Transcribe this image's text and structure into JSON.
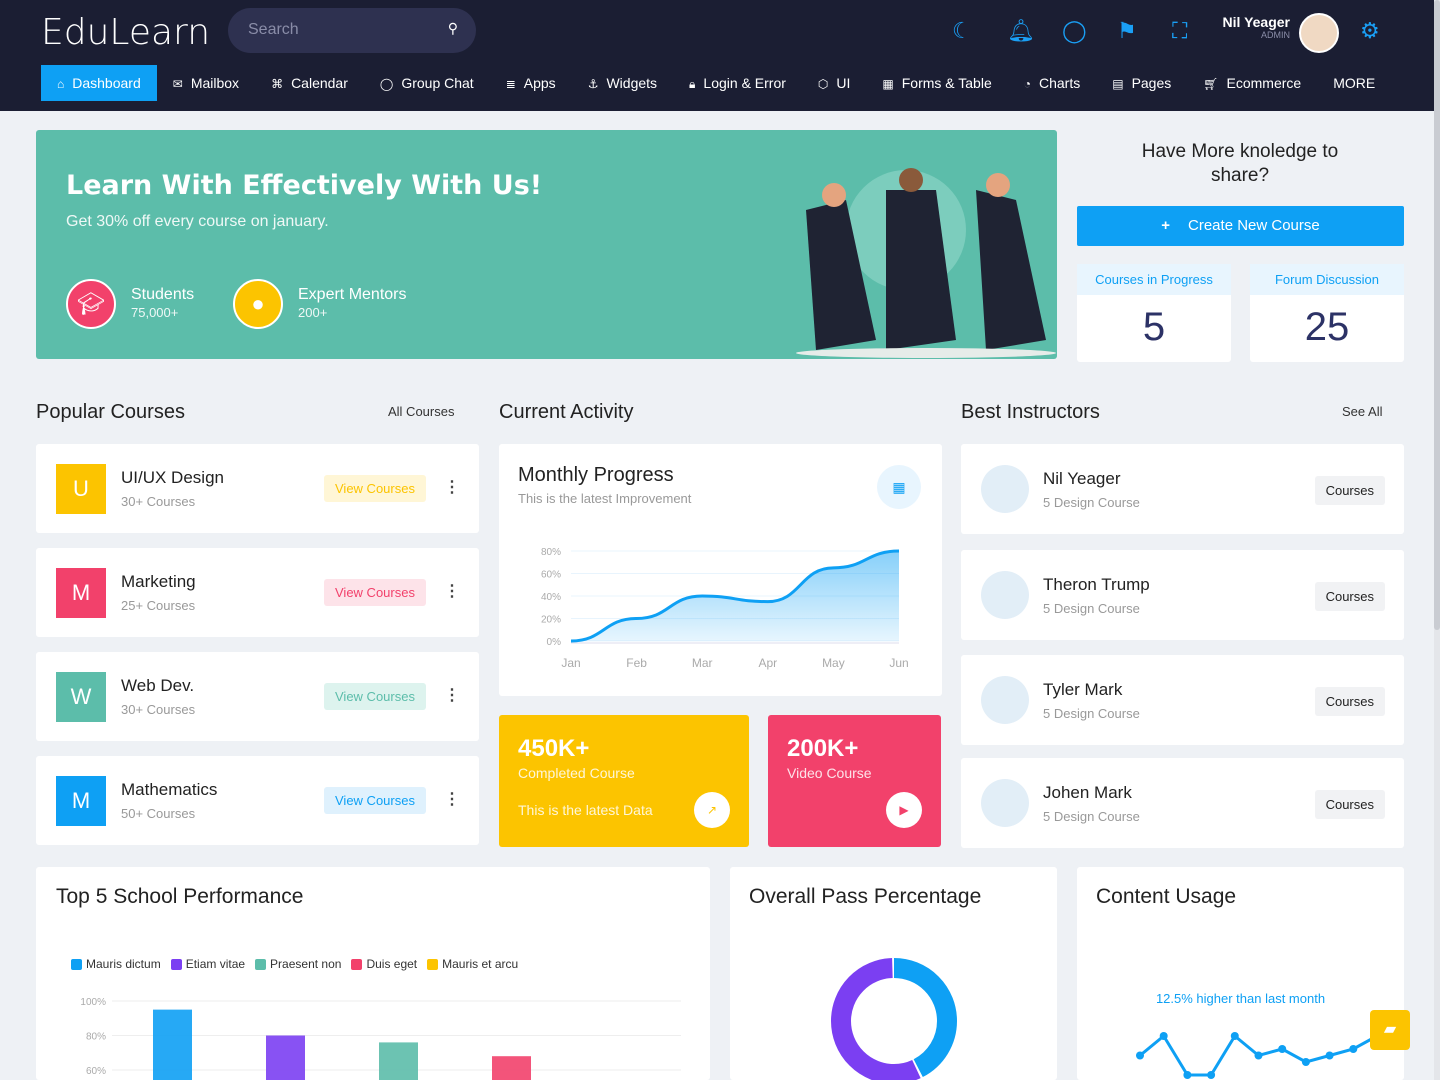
{
  "header": {
    "logo": "EduLearn",
    "search_placeholder": "Search",
    "user_name": "Nil Yeager",
    "user_role": "ADMIN"
  },
  "nav": [
    {
      "label": "Dashboard",
      "icon": "home-icon",
      "active": true
    },
    {
      "label": "Mailbox",
      "icon": "mail-icon"
    },
    {
      "label": "Calendar",
      "icon": "command-icon"
    },
    {
      "label": "Group Chat",
      "icon": "chat-icon"
    },
    {
      "label": "Apps",
      "icon": "database-icon"
    },
    {
      "label": "Widgets",
      "icon": "anchor-icon"
    },
    {
      "label": "Login & Error",
      "icon": "lock-icon"
    },
    {
      "label": "UI",
      "icon": "box-icon"
    },
    {
      "label": "Forms & Table",
      "icon": "table-icon"
    },
    {
      "label": "Charts",
      "icon": "pie-icon"
    },
    {
      "label": "Pages",
      "icon": "file-icon"
    },
    {
      "label": "Ecommerce",
      "icon": "cart-icon"
    },
    {
      "label": "MORE"
    }
  ],
  "hero": {
    "title": "Learn With Effectively With Us!",
    "subtitle": "Get 30% off every course on january.",
    "stats": [
      {
        "label": "Students",
        "value": "75,000+"
      },
      {
        "label": "Expert Mentors",
        "value": "200+"
      }
    ]
  },
  "side": {
    "title": "Have More knoledge to share?",
    "create": "Create New Course",
    "boxes": [
      {
        "label": "Courses in Progress",
        "value": "5"
      },
      {
        "label": "Forum Discussion",
        "value": "25"
      }
    ]
  },
  "popular": {
    "title": "Popular Courses",
    "link": "All Courses",
    "button": "View Courses",
    "items": [
      {
        "letter": "U",
        "name": "UI/UX Design",
        "count": "30+ Courses",
        "color": "#fcc400",
        "bg": "#fff6d6"
      },
      {
        "letter": "M",
        "name": "Marketing",
        "count": "25+ Courses",
        "color": "#f2416b",
        "bg": "#fde3e9"
      },
      {
        "letter": "W",
        "name": "Web Dev.",
        "count": "30+ Courses",
        "color": "#5cbdaa",
        "bg": "#ddf3ee"
      },
      {
        "letter": "M",
        "name": "Mathematics",
        "count": "50+ Courses",
        "color": "#0ea0f4",
        "bg": "#dff1fd"
      }
    ]
  },
  "activity": {
    "title": "Current Activity",
    "card_title": "Monthly Progress",
    "card_sub": "This is the latest Improvement"
  },
  "kpis": [
    {
      "value": "450K+",
      "label": "Completed Course",
      "note": "This is the latest Data",
      "color": "#fcc400"
    },
    {
      "value": "200K+",
      "label": "Video Course",
      "color": "#f2416b"
    }
  ],
  "instructors": {
    "title": "Best Instructors",
    "link": "See All",
    "button": "Courses",
    "items": [
      {
        "name": "Nil Yeager",
        "course": "5 Design Course"
      },
      {
        "name": "Theron Trump",
        "course": "5 Design Course"
      },
      {
        "name": "Tyler Mark",
        "course": "5 Design Course"
      },
      {
        "name": "Johen Mark",
        "course": "5 Design Course"
      }
    ]
  },
  "bottom": {
    "school": "Top 5 School Performance",
    "pass": "Overall Pass Percentage",
    "content": "Content Usage",
    "content_note": "12.5% higher than last month"
  },
  "chart_data": [
    {
      "type": "area",
      "title": "Monthly Progress",
      "categories": [
        "Jan",
        "Feb",
        "Mar",
        "Apr",
        "May",
        "Jun"
      ],
      "values": [
        0,
        20,
        40,
        35,
        65,
        80
      ],
      "yticks": [
        "0%",
        "20%",
        "40%",
        "60%",
        "80%"
      ],
      "ylim": [
        0,
        80
      ],
      "color": "#0ea0f4"
    },
    {
      "type": "bar",
      "title": "Top 5 School Performance",
      "series": [
        {
          "name": "Mauris dictum",
          "value": 95,
          "color": "#0ea0f4"
        },
        {
          "name": "Etiam vitae",
          "value": 80,
          "color": "#7b3ff2"
        },
        {
          "name": "Praesent non",
          "value": 76,
          "color": "#5cbdaa"
        },
        {
          "name": "Duis eget",
          "value": 68,
          "color": "#f2416b"
        },
        {
          "name": "Mauris et arcu",
          "color": "#fcc400"
        }
      ],
      "yticks": [
        "60%",
        "80%",
        "100%"
      ],
      "legend": "top-left"
    },
    {
      "type": "pie",
      "title": "Overall Pass Percentage",
      "values": [
        43,
        57
      ],
      "colors": [
        "#0ea0f4",
        "#7b3ff2"
      ]
    },
    {
      "type": "line",
      "title": "Content Usage",
      "values": [
        3,
        6,
        0,
        0,
        6,
        3,
        4,
        2,
        3,
        4,
        6
      ],
      "color": "#0ea0f4"
    }
  ]
}
